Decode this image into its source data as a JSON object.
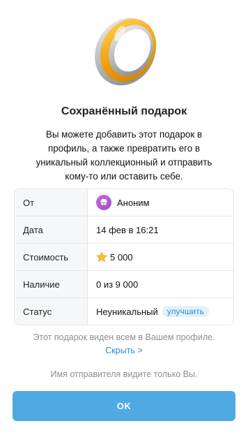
{
  "gift": {
    "image": "silver-gold-ring-icon"
  },
  "title": "Сохранённый подарок",
  "description": "Вы можете добавить этот подарок в профиль, а также превратить его в уникальный коллекционный и отправить кому-то или оставить себе.",
  "details": {
    "from_label": "От",
    "from_value": "Аноним",
    "from_icon": "anonymous-avatar-icon",
    "date_label": "Дата",
    "date_value": "14 фев в 16:21",
    "cost_label": "Стоимость",
    "cost_value": "5 000",
    "cost_icon": "star-icon",
    "availability_label": "Наличие",
    "availability_value": "0 из 9 000",
    "status_label": "Статус",
    "status_value": "Неуникальный",
    "upgrade_label": "улучшить"
  },
  "visibility": {
    "text": "Этот подарок виден всем в Вашем профиле.",
    "hide_link": "Скрыть >"
  },
  "sender_note": "Имя отправителя видите только Вы.",
  "ok_button": "OK",
  "colors": {
    "accent": "#4fa9e2",
    "link": "#2a8bd4",
    "muted_text": "#8a8f94",
    "label_bg": "#f6f7f9"
  }
}
